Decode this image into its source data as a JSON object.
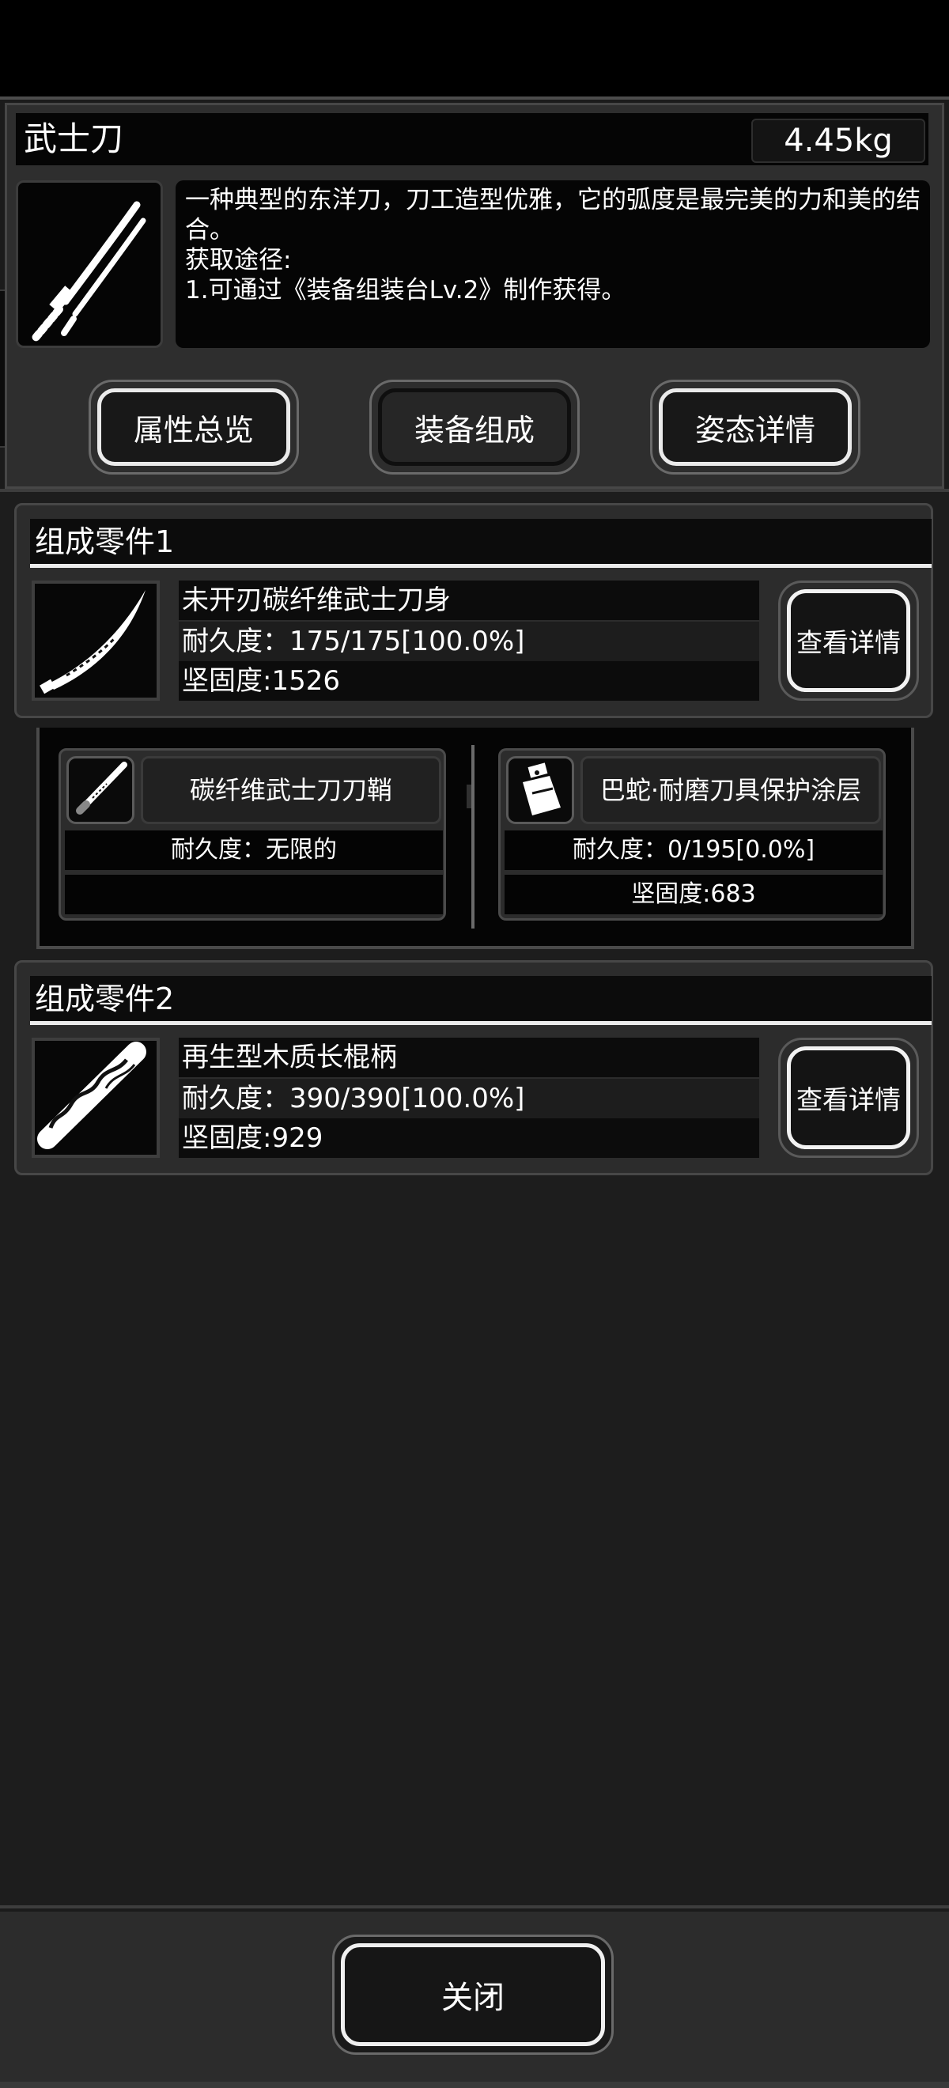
{
  "item": {
    "name": "武士刀",
    "weight": "4.45kg",
    "description": "一种典型的东洋刀，刀工造型优雅，它的弧度是最完美的力和美的结合。",
    "source_label": "获取途径:",
    "source_text": "1.可通过《装备组装台Lv.2》制作获得。",
    "icon": "katana-icon"
  },
  "tabs": [
    {
      "label": "属性总览",
      "state": "bracket"
    },
    {
      "label": "装备组成",
      "state": "active"
    },
    {
      "label": "姿态详情",
      "state": "bracket"
    }
  ],
  "parts": [
    {
      "header": "组成零件1",
      "name": "未开刃碳纤维武士刀身",
      "durability": "耐久度：175/175[100.0%]",
      "hardness": "坚固度:1526",
      "detail_label": "查看详情",
      "icon": "blade-icon"
    },
    {
      "header": "组成零件2",
      "name": "再生型木质长棍柄",
      "durability": "耐久度：390/390[100.0%]",
      "hardness": "坚固度:929",
      "detail_label": "查看详情",
      "icon": "wooden-handle-icon"
    }
  ],
  "subparts": [
    {
      "name": "碳纤维武士刀刀鞘",
      "durability": "耐久度：无限的",
      "hardness": "",
      "icon": "scabbard-icon"
    },
    {
      "name": "巴蛇·耐磨刀具保护涂层",
      "durability": "耐久度：0/195[0.0%]",
      "hardness": "坚固度:683",
      "icon": "coating-bottle-icon"
    }
  ],
  "footer": {
    "close_label": "关闭"
  }
}
